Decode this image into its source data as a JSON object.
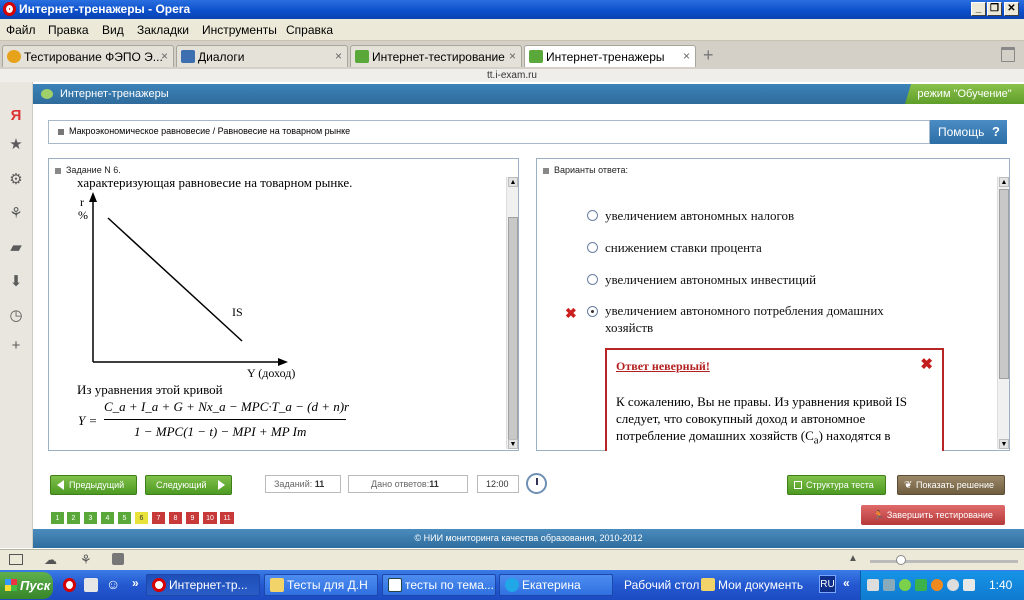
{
  "window": {
    "title": "Интернет-тренажеры - Opera"
  },
  "menu": [
    "Файл",
    "Правка",
    "Вид",
    "Закладки",
    "Инструменты",
    "Справка"
  ],
  "tabs": [
    {
      "label": "Тестирование ФЭПО Э...",
      "close": "×",
      "active": false
    },
    {
      "label": "Диалоги",
      "close": "×",
      "active": false
    },
    {
      "label": "Интернет-тестирование",
      "close": "×",
      "active": false
    },
    {
      "label": "Интернет-тренажеры",
      "close": "×",
      "active": true
    }
  ],
  "address": "tt.i-exam.ru",
  "app": {
    "header_title": "Интернет-тренажеры",
    "mode": "режим \"Обучение\"",
    "breadcrumb": "Макроэкономическое равновесие / Равновесие на товарном рынке",
    "help": "Помощь",
    "help_icon": "?"
  },
  "question": {
    "header": "Задание N 6.",
    "text_top": "характеризующая равновесие на товарном рынке.",
    "graph": {
      "y_label": "r",
      "y_unit": "%",
      "curve_label": "IS",
      "x_label": "Y (доход)"
    },
    "equation_intro": "Из уравнения этой кривой",
    "formula": {
      "lhs": "Y =",
      "numerator": "C_a + I_a + G + Nx_a − MPC·T_a − (d + n)r",
      "denominator": "1 − MPC(1 − t) − MPI + MP Im"
    }
  },
  "answers": {
    "header": "Варианты ответа:",
    "options": [
      {
        "label": "увеличением автономных налогов",
        "selected": false
      },
      {
        "label": "снижением ставки процента",
        "selected": false
      },
      {
        "label": "увеличением автономных инвестиций",
        "selected": false
      },
      {
        "label_line1": "увеличением автономного потребления домашних",
        "label_line2": "хозяйств",
        "selected": true,
        "wrong": true
      }
    ],
    "wrong_mark": "✖",
    "feedback": {
      "title": "Ответ неверный!",
      "close": "✖",
      "body": "К сожалению, Вы не правы. Из уравнения кривой IS следует, что совокупный доход и автономное потребление домашних хозяйств (C",
      "body_sub": "a",
      "body_end": ") находятся в"
    }
  },
  "nav": {
    "prev": "Предыдущий",
    "next": "Следующий",
    "tasks_label": "Заданий:",
    "tasks_value": "11",
    "answered_label": "Дано ответов:",
    "answered_value": "11",
    "time": "12:00",
    "structure": "Структура теста",
    "show_solution": "Показать решение",
    "finish": "Завершить тестирование",
    "numbers": [
      "1",
      "2",
      "3",
      "4",
      "5",
      "6",
      "7",
      "8",
      "9",
      "10",
      "11"
    ],
    "number_colors": [
      "#5aa83a",
      "#5aa83a",
      "#5aa83a",
      "#5aa83a",
      "#5aa83a",
      "#e8e23a",
      "#c83a3a",
      "#c83a3a",
      "#c83a3a",
      "#c83a3a",
      "#c83a3a"
    ]
  },
  "footer": "© НИИ мониторинга качества образования, 2010-2012",
  "taskbar": {
    "start": "Пуск",
    "tasks": [
      "Интернет-тр...",
      "Тесты для Д.Н",
      "тесты по тема...",
      "Екатерина"
    ],
    "desktop": "Рабочий стол",
    "docs": "Мои документь",
    "lang": "RU",
    "time": "1:40"
  }
}
